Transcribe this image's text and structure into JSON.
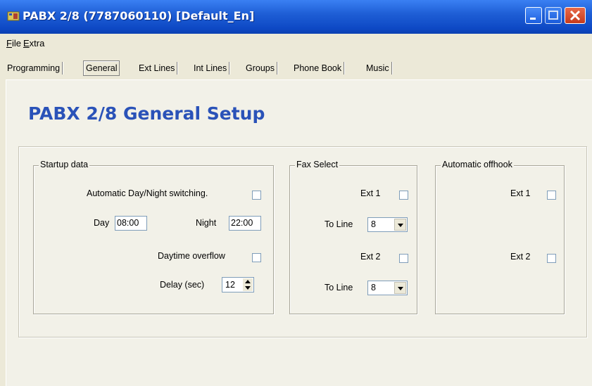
{
  "window": {
    "title": "PABX 2/8 (7787060110) [Default_En]"
  },
  "menu": [
    {
      "label": "File",
      "accel": "F"
    },
    {
      "label": "Extra",
      "accel": "E"
    }
  ],
  "tabs": [
    {
      "label": "Programming",
      "active": false
    },
    {
      "label": "General",
      "active": true
    },
    {
      "label": "Ext Lines",
      "active": false
    },
    {
      "label": "Int Lines",
      "active": false
    },
    {
      "label": "Groups",
      "active": false
    },
    {
      "label": "Phone Book",
      "active": false
    },
    {
      "label": "Music",
      "active": false
    }
  ],
  "page_title": "PABX 2/8 General Setup",
  "startup": {
    "legend": "Startup data",
    "auto_switch_label": "Automatic Day/Night switching.",
    "auto_switch_checked": false,
    "day_label": "Day",
    "day_value": "08:00",
    "night_label": "Night",
    "night_value": "22:00",
    "overflow_label": "Daytime overflow",
    "overflow_checked": false,
    "delay_label": "Delay (sec)",
    "delay_value": "12"
  },
  "fax": {
    "legend": "Fax Select",
    "ext1_label": "Ext 1",
    "ext1_checked": false,
    "toline1_label": "To Line",
    "toline1_value": "8",
    "ext2_label": "Ext 2",
    "ext2_checked": false,
    "toline2_label": "To Line",
    "toline2_value": "8"
  },
  "offhook": {
    "legend": "Automatic offhook",
    "ext1_label": "Ext 1",
    "ext1_checked": false,
    "ext2_label": "Ext 2",
    "ext2_checked": false
  },
  "colors": {
    "title_bar": "#1f5fd6",
    "page_title": "#2a52b8",
    "background": "#ece9d8"
  }
}
